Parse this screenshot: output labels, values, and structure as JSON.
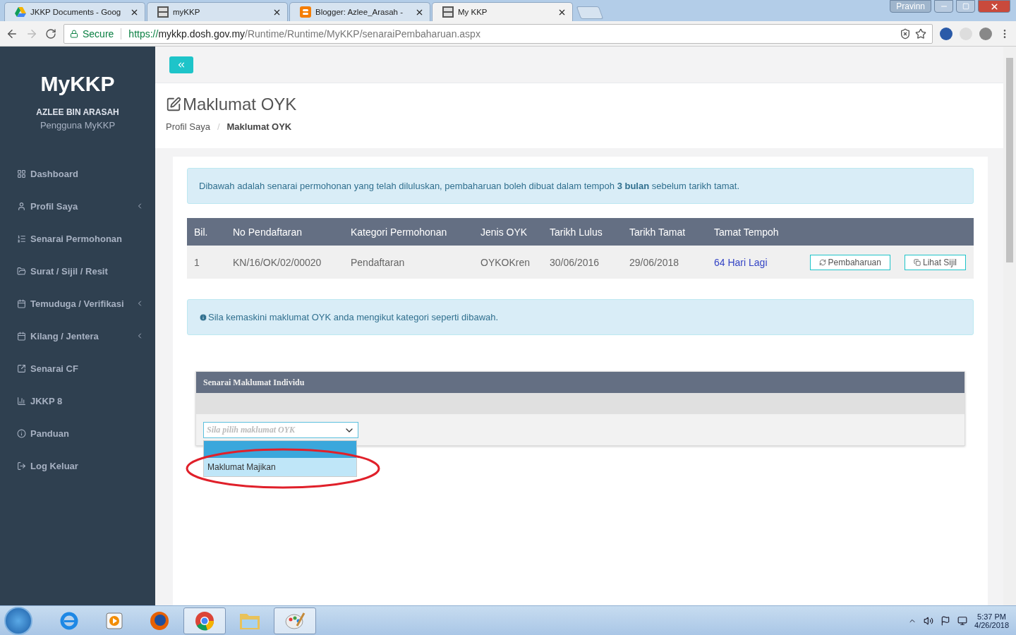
{
  "browser": {
    "tabs": [
      {
        "title": "JKKP Documents - Goog",
        "kind": "drive",
        "selected": false
      },
      {
        "title": "myKKP",
        "kind": "mykkp",
        "selected": false
      },
      {
        "title": "Blogger: Azlee_Arasah -",
        "kind": "blogger",
        "selected": false
      },
      {
        "title": "My KKP",
        "kind": "mykkp",
        "selected": true
      }
    ],
    "profile": "Pravinn",
    "address": {
      "secure_label": "Secure",
      "scheme": "https://",
      "host": "mykkp.dosh.gov.my",
      "path": "/Runtime/Runtime/MyKKP/senaraiPembaharuan.aspx"
    }
  },
  "sidebar": {
    "brand": "MyKKP",
    "user_name": "AZLEE BIN ARASAH",
    "user_role": "Pengguna MyKKP",
    "items": [
      {
        "label": "Dashboard",
        "kind": "grid",
        "submenu": false
      },
      {
        "label": "Profil Saya",
        "kind": "user",
        "submenu": true
      },
      {
        "label": "Senarai Permohonan",
        "kind": "list",
        "submenu": false
      },
      {
        "label": "Surat / Sijil / Resit",
        "kind": "folder",
        "submenu": false
      },
      {
        "label": "Temuduga / Verifikasi",
        "kind": "calendar",
        "submenu": true
      },
      {
        "label": "Kilang / Jentera",
        "kind": "calendar",
        "submenu": true
      },
      {
        "label": "Senarai CF",
        "kind": "external",
        "submenu": false
      },
      {
        "label": "JKKP 8",
        "kind": "chart",
        "submenu": false
      },
      {
        "label": "Panduan",
        "kind": "info",
        "submenu": false
      },
      {
        "label": "Log Keluar",
        "kind": "logout",
        "submenu": false
      }
    ]
  },
  "header": {
    "title": "Maklumat OYK",
    "breadcrumb": [
      "Profil Saya",
      "Maklumat OYK"
    ],
    "breadcrumb_separator": "/"
  },
  "notice": "Dibawah adalah senarai permohonan yang telah diluluskan, pembaharuan boleh dibuat dalam tempoh **3 bulan** sebelum tarikh tamat.",
  "table": {
    "columns": [
      "Bil.",
      "No Pendaftaran",
      "Kategori Permohonan",
      "Jenis OYK",
      "Tarikh Lulus",
      "Tarikh Tamat",
      "Tamat Tempoh"
    ],
    "rows": [
      {
        "cells": [
          "1",
          "KN/16/OK/02/00020",
          "Pendaftaran",
          "OYKOKren",
          "30/06/2016",
          "29/06/2018"
        ],
        "remaining": "64 Hari Lagi",
        "actions": [
          {
            "label": "Pembaharuan",
            "kind": "renew"
          },
          {
            "label": "Lihat Sijil",
            "kind": "copy"
          }
        ]
      }
    ]
  },
  "hint": "Sila kemaskini maklumat OYK anda mengikut kategori seperti dibawah.",
  "panel": {
    "title": "Senarai Maklumat Individu",
    "select_placeholder": "Sila pilih maklumat OYK",
    "blank_option_highlighted": true,
    "options": [
      {
        "label": "Maklumat Majikan",
        "selected": false
      }
    ],
    "annotation_circled": true
  },
  "taskbar": {
    "apps": [
      {
        "kind": "ie",
        "open": false
      },
      {
        "kind": "media",
        "open": false
      },
      {
        "kind": "firefox",
        "open": false
      },
      {
        "kind": "chrome",
        "open": true
      },
      {
        "kind": "explorer",
        "open": false
      },
      {
        "kind": "paint",
        "open": true
      }
    ],
    "time": "5:37 PM",
    "date": "4/26/2018"
  }
}
